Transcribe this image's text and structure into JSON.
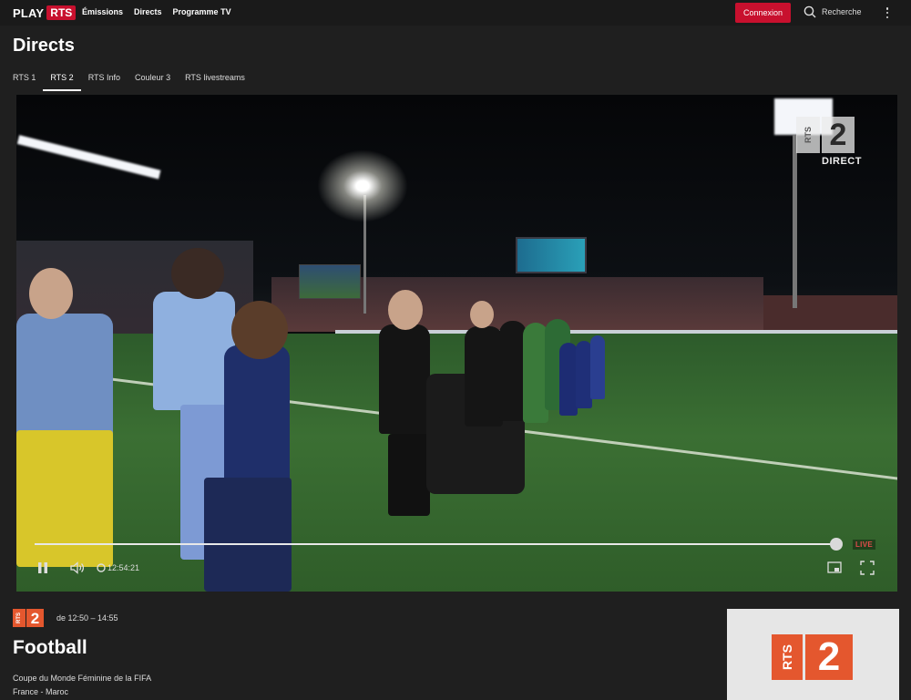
{
  "header": {
    "logo_play": "PLAY",
    "logo_rts": "RTS",
    "nav": [
      "Émissions",
      "Directs",
      "Programme TV"
    ],
    "login_label": "Connexion",
    "search_label": "Recherche",
    "search_icon": "search-icon",
    "more_icon": "more-vertical-icon"
  },
  "page": {
    "title": "Directs",
    "tabs": [
      "RTS 1",
      "RTS 2",
      "RTS Info",
      "Couleur 3",
      "RTS livestreams"
    ],
    "active_tab": "RTS 2"
  },
  "player": {
    "watermark_channel": "RTS",
    "watermark_number": "2",
    "watermark_status": "DIRECT",
    "progress_fraction": 0.998,
    "live_label": "LIVE",
    "time": "12:54:21",
    "icons": [
      "pause-icon",
      "volume-icon",
      "cast-icon",
      "fullscreen-icon"
    ]
  },
  "program": {
    "channel_rts": "RTS",
    "channel_number": "2",
    "time_range": "de 12:50 – 14:55",
    "title": "Football",
    "subtitle": "Coupe du Monde Féminine de la FIFA",
    "match": "France - Maroc"
  },
  "colors": {
    "brand_red": "#c8102e",
    "rts2_orange": "#e4572e",
    "background": "#1f1f1f"
  }
}
